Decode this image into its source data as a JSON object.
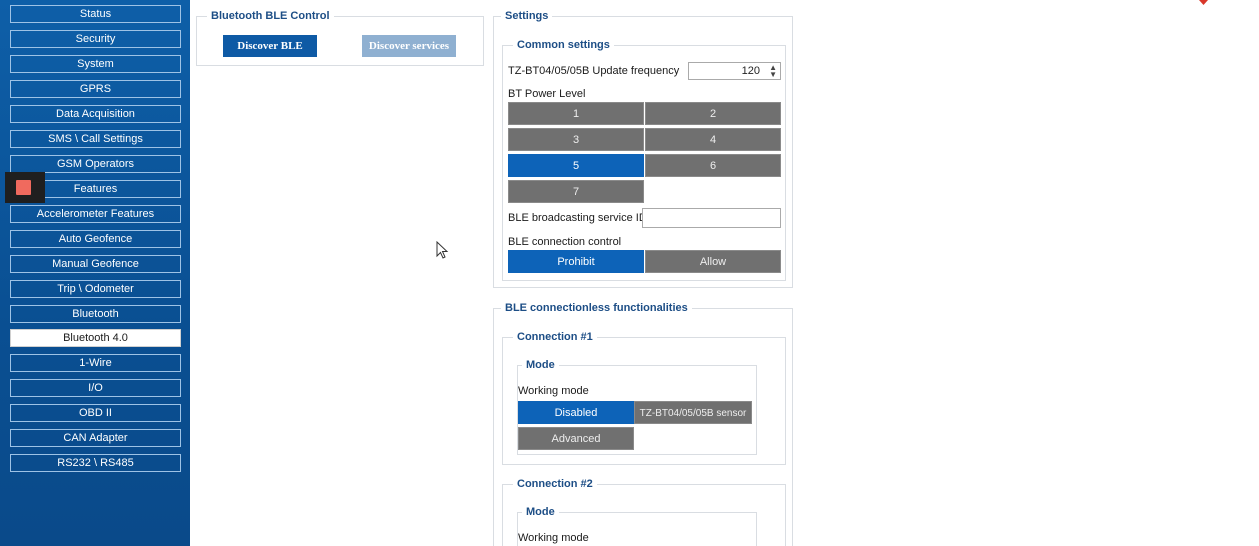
{
  "sidebar": {
    "items": [
      {
        "label": "Status"
      },
      {
        "label": "Security"
      },
      {
        "label": "System"
      },
      {
        "label": "GPRS"
      },
      {
        "label": "Data Acquisition"
      },
      {
        "label": "SMS \\ Call Settings"
      },
      {
        "label": "GSM Operators"
      },
      {
        "label": "Features"
      },
      {
        "label": "Accelerometer Features"
      },
      {
        "label": "Auto Geofence"
      },
      {
        "label": "Manual Geofence"
      },
      {
        "label": "Trip \\ Odometer"
      },
      {
        "label": "Bluetooth"
      },
      {
        "label": "Bluetooth 4.0"
      },
      {
        "label": "1-Wire"
      },
      {
        "label": "I/O"
      },
      {
        "label": "OBD II"
      },
      {
        "label": "CAN Adapter"
      },
      {
        "label": "RS232 \\ RS485"
      }
    ],
    "active_index": 13
  },
  "ble_control": {
    "title": "Bluetooth BLE Control",
    "discover_ble": "Discover BLE",
    "discover_services": "Discover services"
  },
  "settings": {
    "title": "Settings",
    "common": {
      "title": "Common settings",
      "update_freq_label": "TZ-BT04/05/05B Update frequency",
      "update_freq_value": "120",
      "power_label": "BT Power Level",
      "power_levels": [
        "1",
        "2",
        "3",
        "4",
        "5",
        "6",
        "7"
      ],
      "power_selected": "5",
      "service_id_label": "BLE broadcasting service ID",
      "service_id_value": "",
      "conn_control_label": "BLE connection control",
      "conn_prohibit": "Prohibit",
      "conn_allow": "Allow",
      "conn_selected": "Prohibit"
    }
  },
  "connectionless": {
    "title": "BLE connectionless functionalities",
    "connection1": {
      "title": "Connection #1",
      "mode_title": "Mode",
      "working_mode_label": "Working mode",
      "disabled": "Disabled",
      "sensor": "TZ-BT04/05/05B sensor",
      "advanced": "Advanced",
      "selected": "Disabled"
    },
    "connection2": {
      "title": "Connection #2",
      "mode_title": "Mode",
      "working_mode_label": "Working mode"
    }
  },
  "colors": {
    "sidebar": "#0e5fa8",
    "accent": "#0d63b8",
    "tile_gray": "#707070",
    "group_title": "#1d4e86"
  }
}
